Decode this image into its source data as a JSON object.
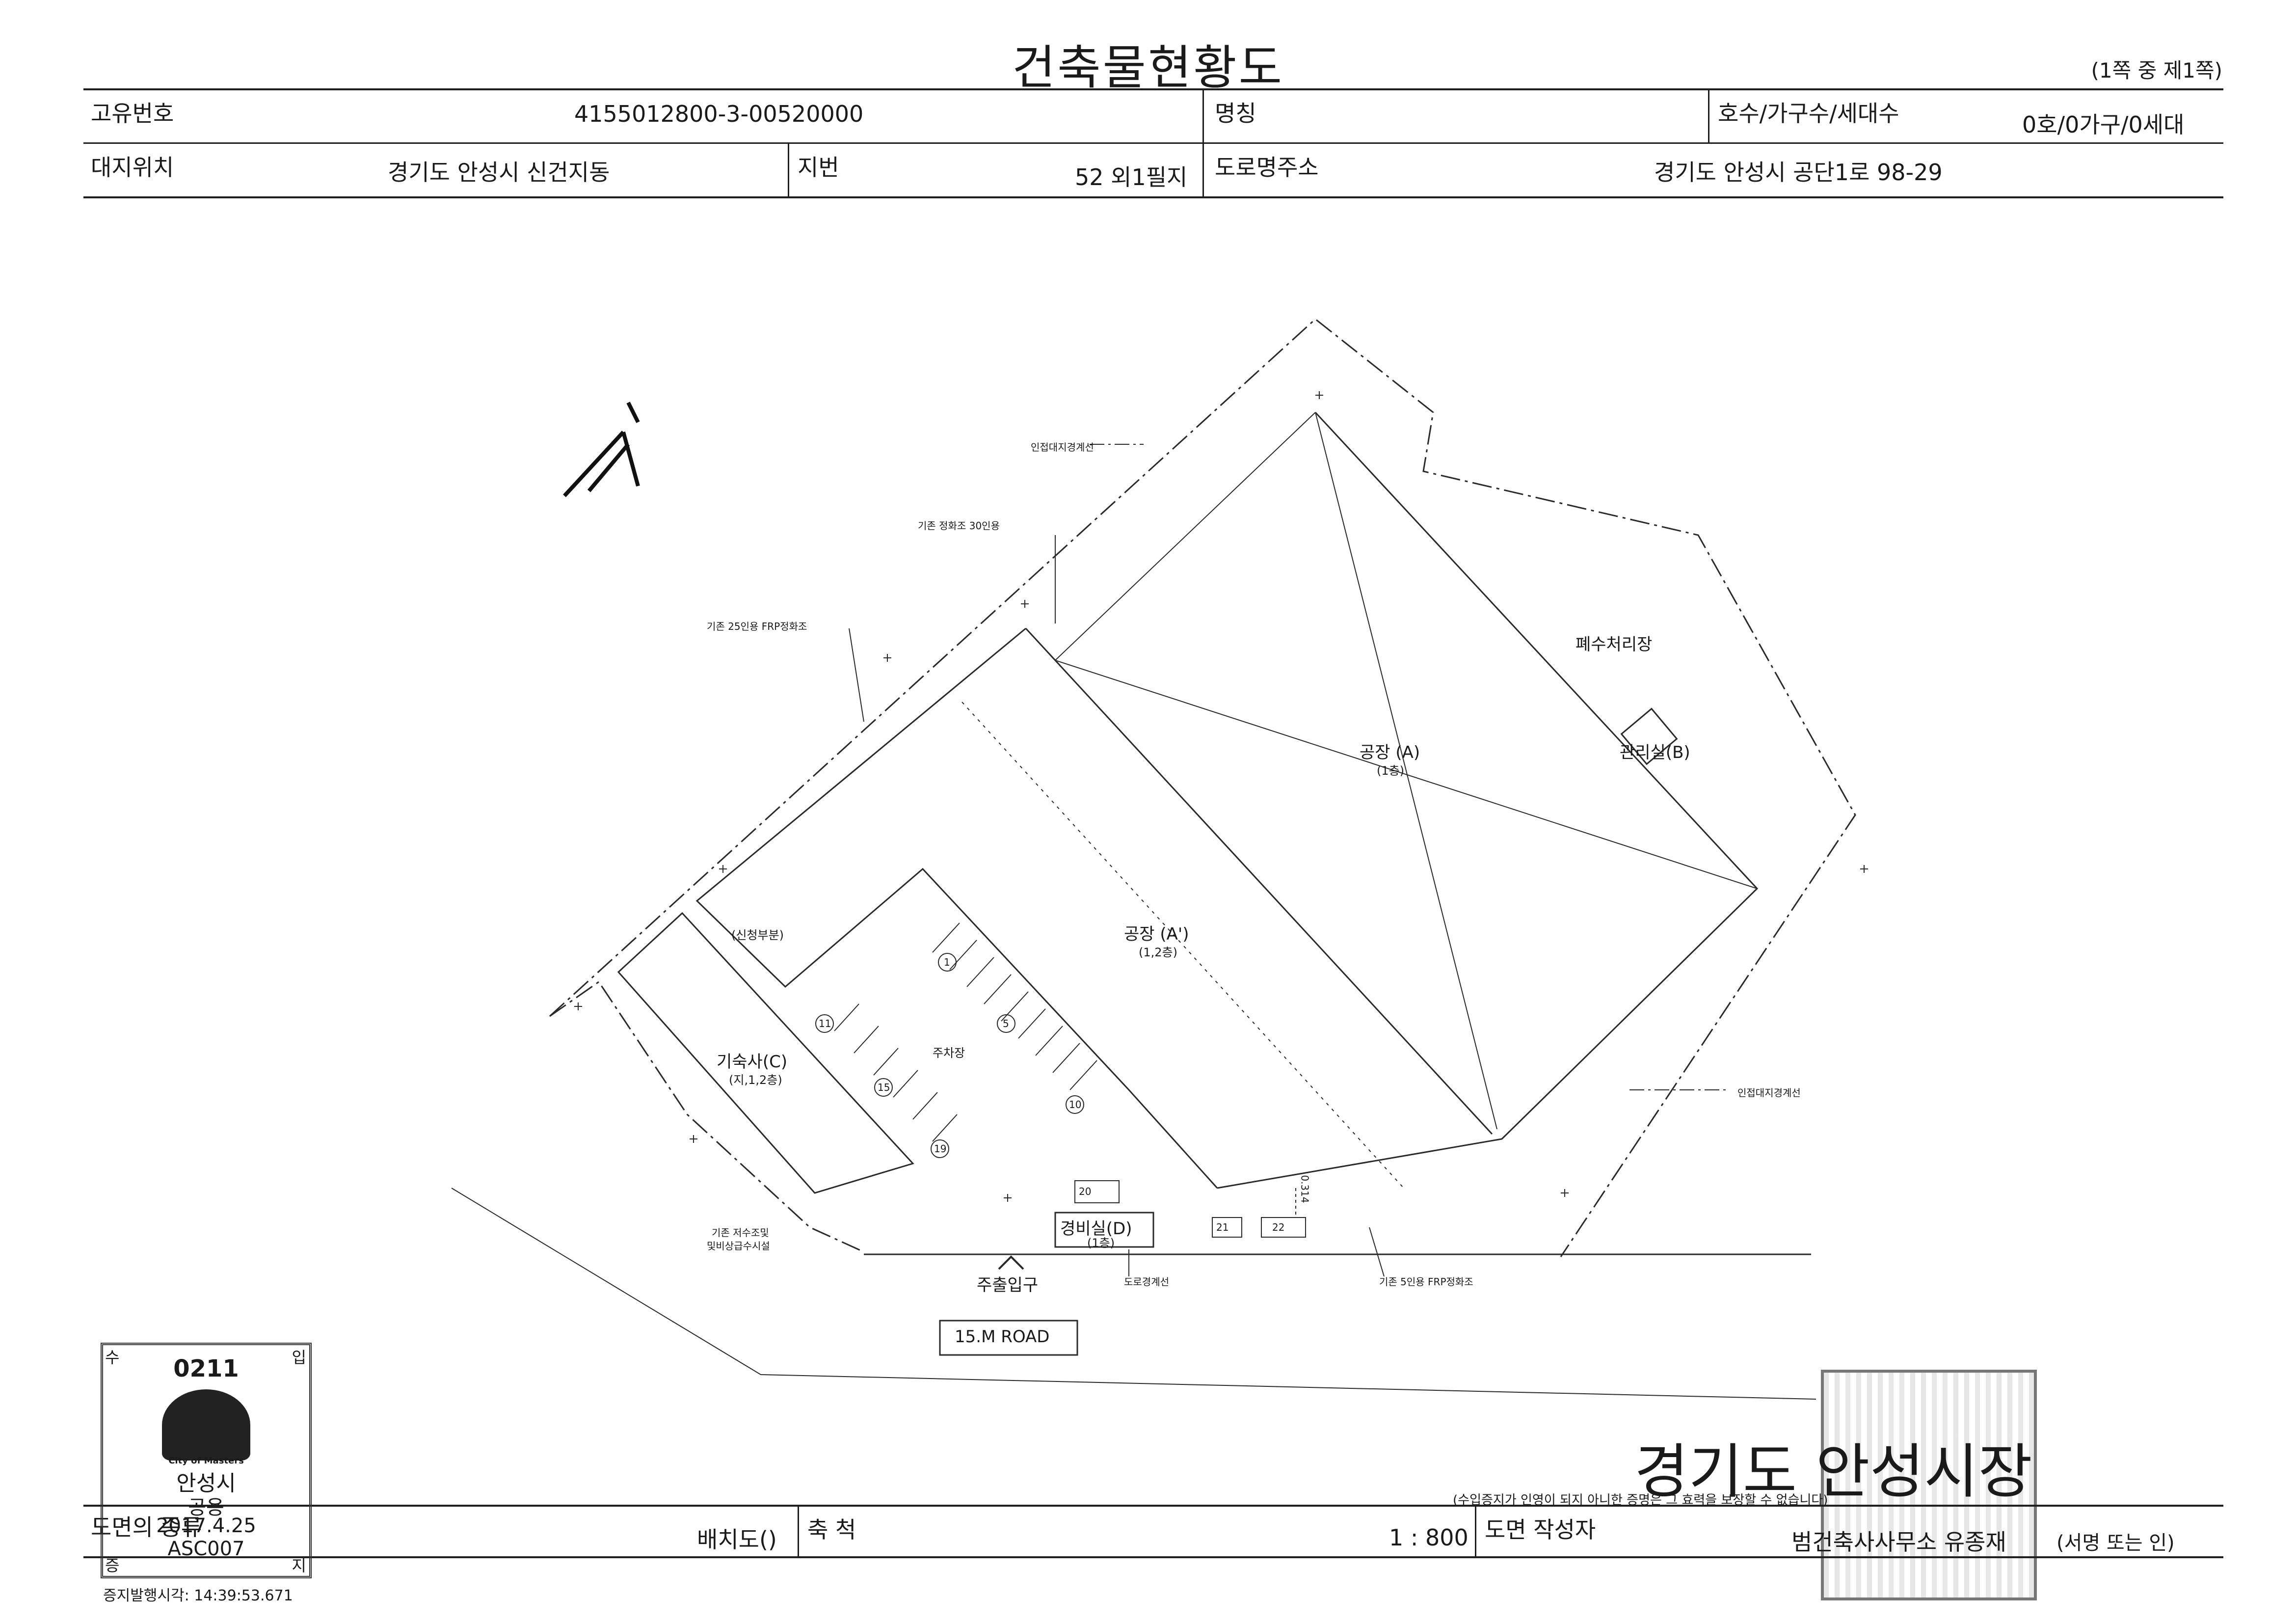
{
  "document": {
    "title": "건축물현황도",
    "page_info": "(1쪽 중 제1쪽)"
  },
  "header": {
    "unique_no_label": "고유번호",
    "unique_no_value": "4155012800-3-00520000",
    "name_label": "명칭",
    "name_value": "",
    "units_label": "호수/가구수/세대수",
    "units_value": "0호/0가구/0세대",
    "site_label": "대지위치",
    "site_value": "경기도 안성시 신건지동",
    "lot_label": "지번",
    "lot_value": "52 외1필지",
    "road_label": "도로명주소",
    "road_value": "경기도 안성시 공단1로 98-29"
  },
  "plan": {
    "north_mark": "N",
    "labels": {
      "adjacent_boundary_top": "인접대지경계선",
      "existing_septic_30": "기존 정화조 30인용",
      "existing_frp_25": "기존 25인용 FRP정화조",
      "wastewater": "폐수처리장",
      "factory_a": "공장 (A)",
      "factory_a_floors": "(1층)",
      "mgmt_b": "관리실(B)",
      "application_part": "(신청부분)",
      "factory_a2": "공장 (A')",
      "factory_a2_floors": "(1,2층)",
      "dormitory_c": "기숙사(C)",
      "dormitory_c_floors": "(지,1,2층)",
      "parking": "주차장",
      "adjacent_boundary_right": "인접대지경계선",
      "guard_d": "경비실(D)",
      "guard_d_floors": "(1층)",
      "main_entrance": "주출입구",
      "road_boundary": "도로경계선",
      "existing_frp_5": "기존 5인용 FRP정화조",
      "existing_water_tank": "기존 저수조및",
      "existing_water_tank2": "및비상급수시설",
      "road": "15.M ROAD",
      "dim_note": "0.314"
    },
    "parking_nums": [
      "1",
      "5",
      "10",
      "11",
      "15",
      "19",
      "20",
      "21",
      "22"
    ]
  },
  "footer": {
    "issuer": "경기도 안성시장",
    "issuer_note": "(수입증지가 인영이 되지 아니한 증명은 그 효력을 보장할 수 없습니다)",
    "drawing_type_label": "도면의 종류",
    "drawing_type_value": "배치도()",
    "scale_label": "축 척",
    "scale_value": "1 : 800",
    "author_label": "도면 작성자",
    "author_value": "범건축사사무소 유종재",
    "sign_note": "(서명 또는 인)",
    "issue_time": "증지발행시각: 14:39:53.671"
  },
  "stamp": {
    "corner_tl": "수",
    "corner_tr": "입",
    "corner_bl": "증",
    "corner_br": "지",
    "number": "0211",
    "city_motto": "City of Masters",
    "city": "안성시",
    "use": "공용",
    "date": "2017.4.25",
    "code": "ASC007"
  },
  "colors": {
    "ink": "#1f1f1f",
    "seal_gray": "#777777"
  }
}
